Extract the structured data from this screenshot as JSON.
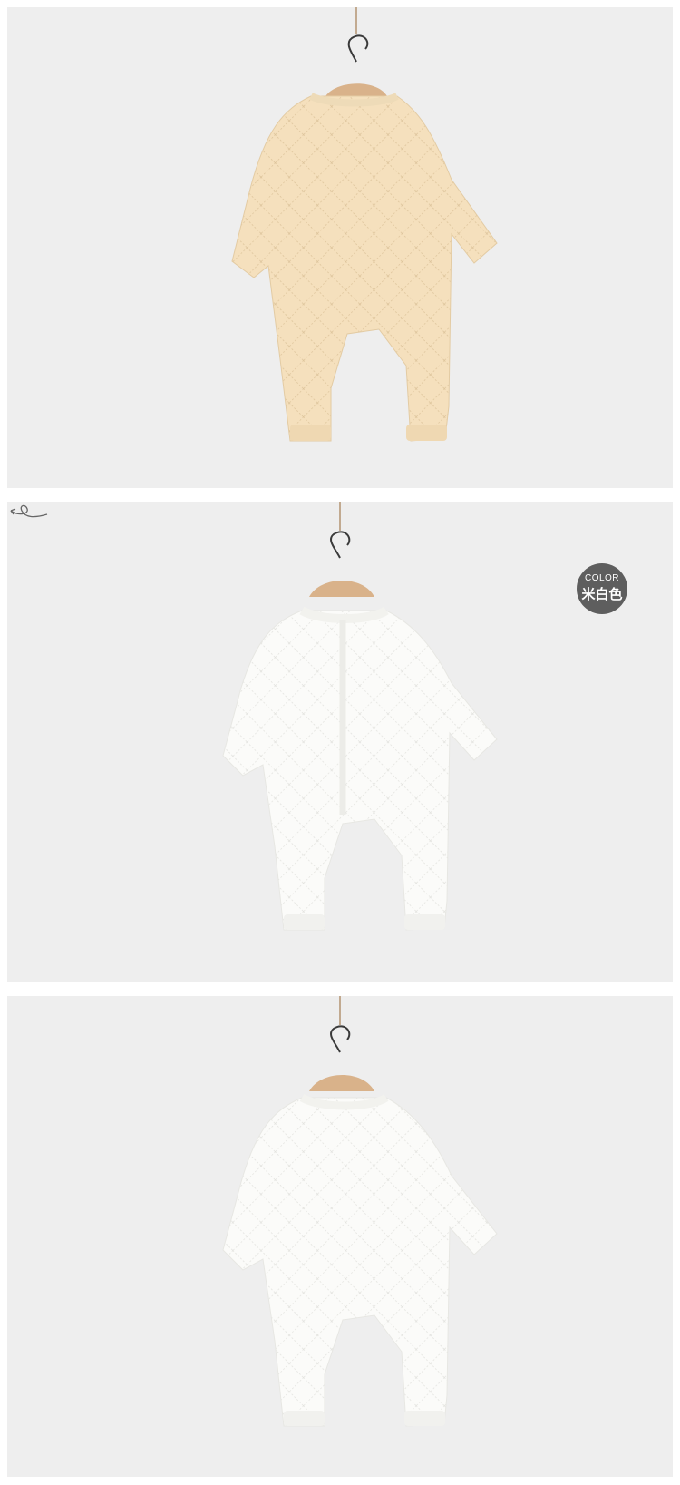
{
  "panels": [
    {
      "view": "back",
      "garment_color": "#f5e0bd"
    },
    {
      "view": "front",
      "garment_color": "#fbfbf9"
    },
    {
      "view": "back",
      "garment_color": "#fbfbf9"
    }
  ],
  "color_badge": {
    "label_en": "COLOR",
    "label_cn": "米白色",
    "bg": "#5e5e5e"
  }
}
